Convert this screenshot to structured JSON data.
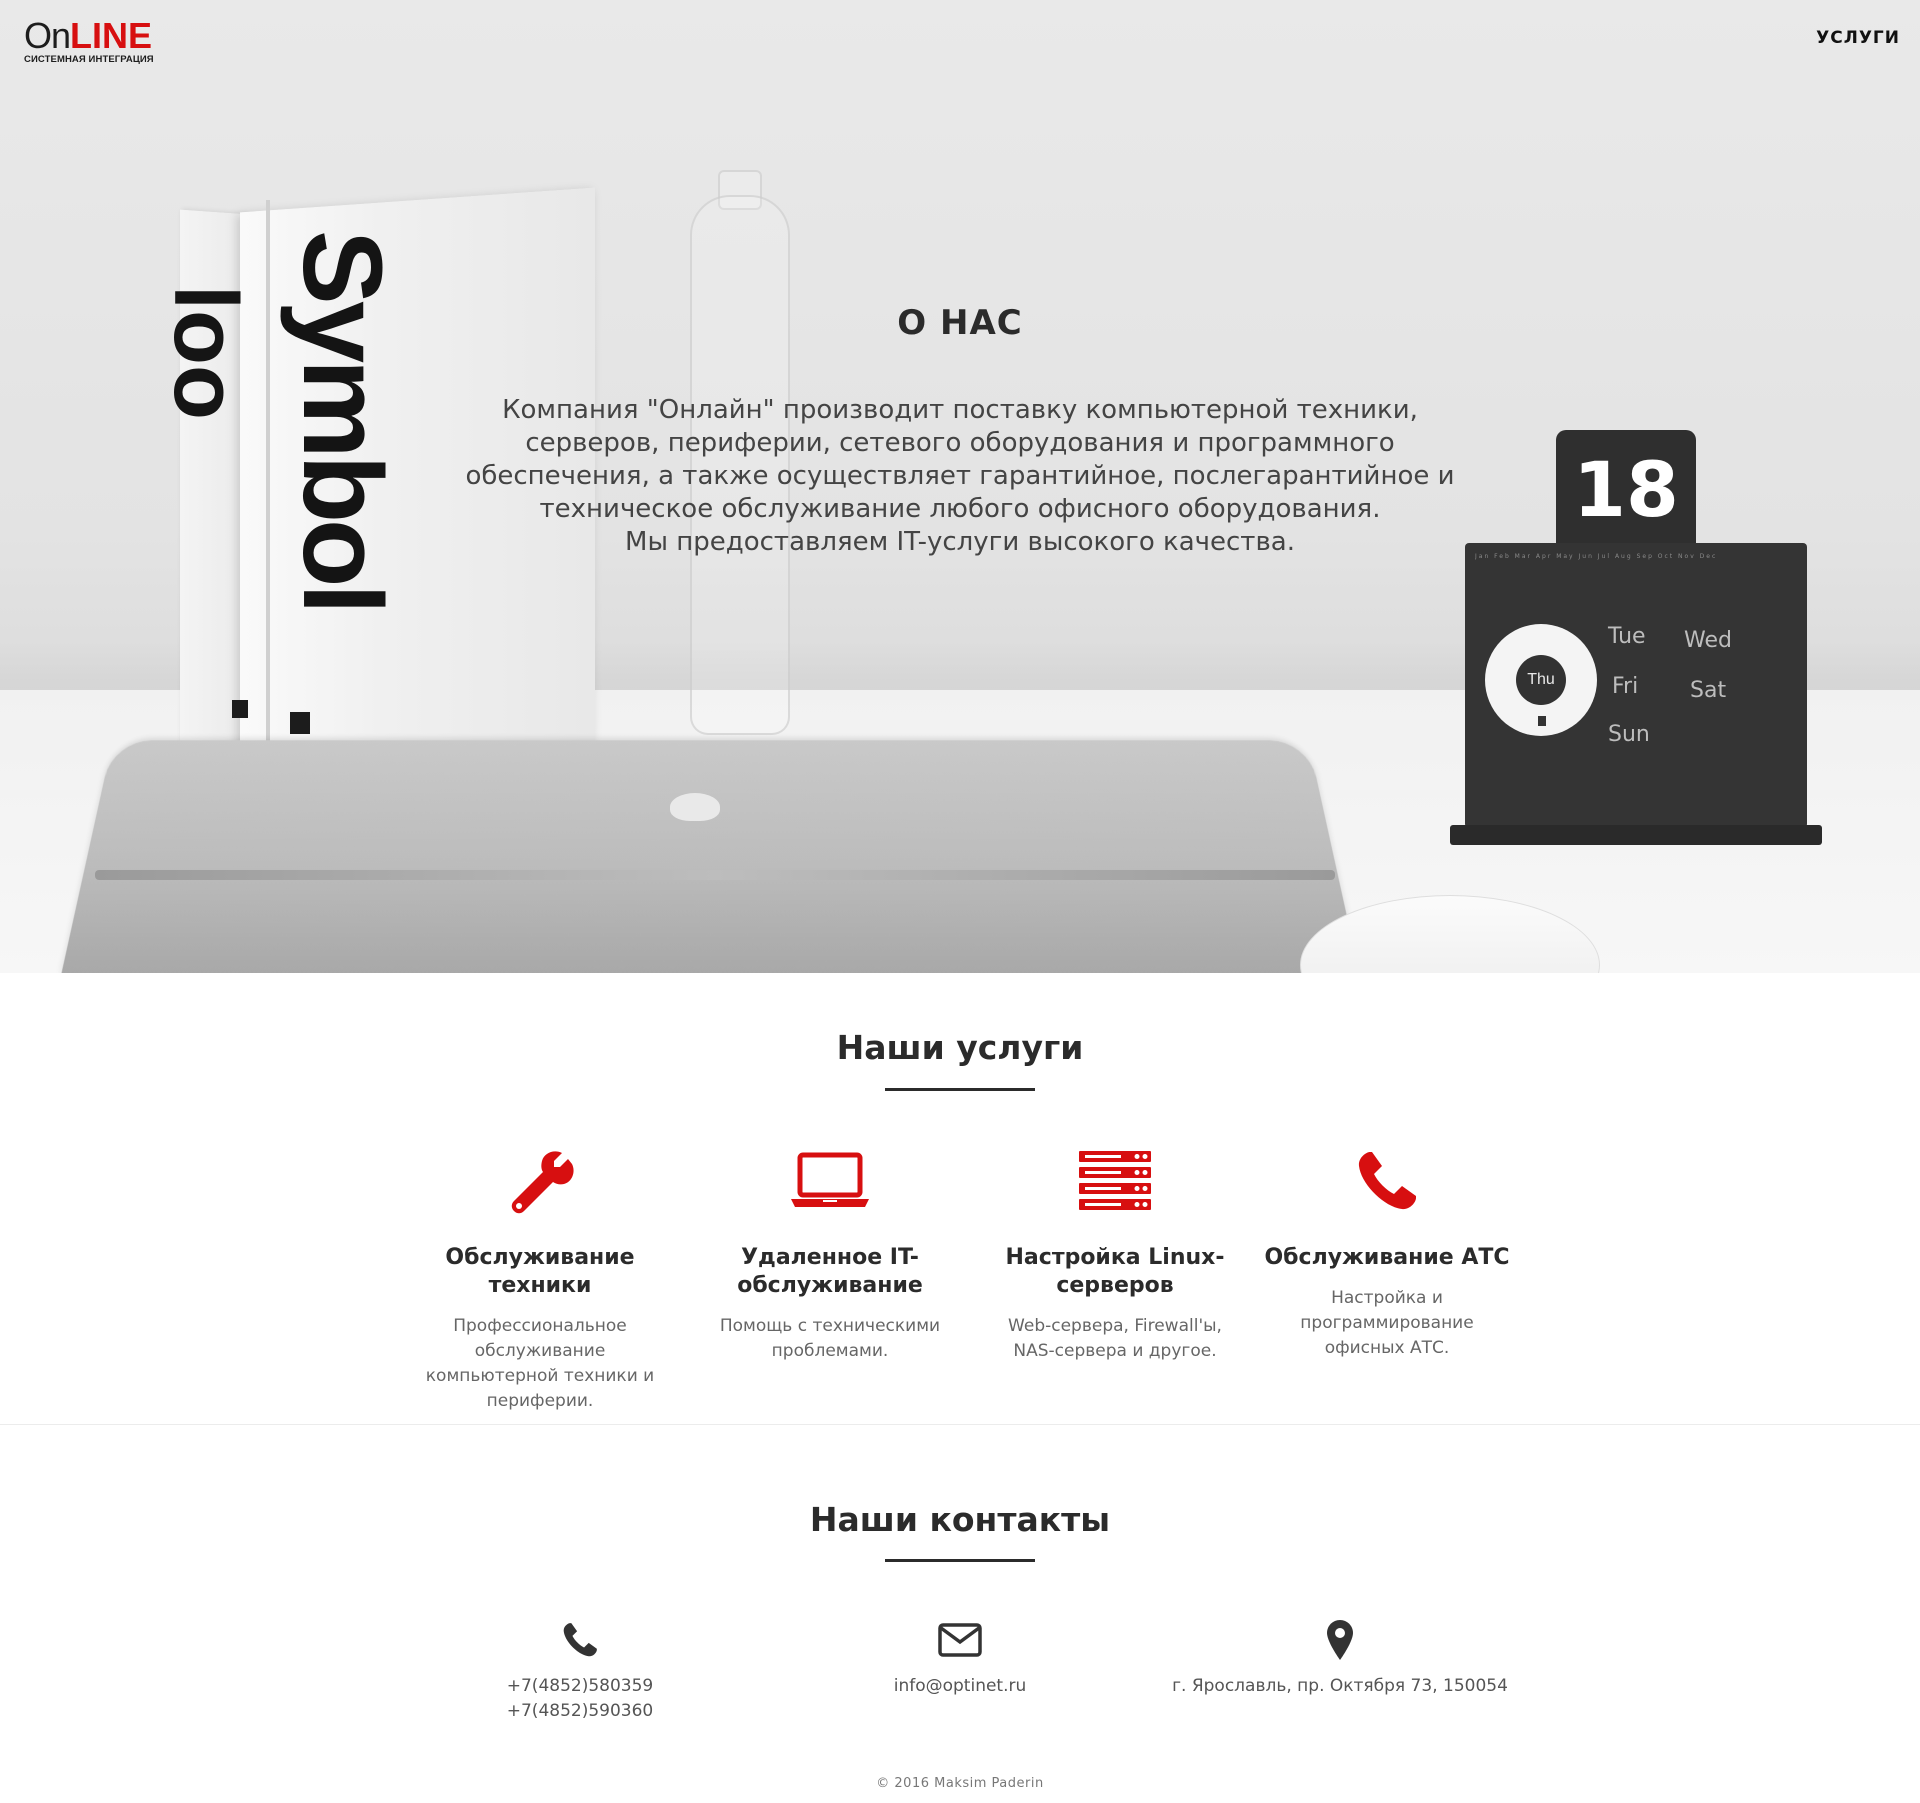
{
  "header": {
    "logo": {
      "on": "On",
      "line": "LINE",
      "subtitle": "СИСТЕМНАЯ ИНТЕГРАЦИЯ"
    },
    "nav": {
      "services": "УСЛУГИ"
    }
  },
  "hero": {
    "title": "О НАС",
    "lines": [
      "Компания \"Онлайн\" производит поставку компьютерной техники,",
      "серверов, периферии, сетевого оборудования и программного",
      "обеспечения, а также осуществляет гарантийное, послегарантийное и",
      "техническое обслуживание любого офисного оборудования.",
      "Мы предоставляем IT-услуги высокого качества."
    ],
    "photo": {
      "book_text": "Symbol",
      "book_text_2": "loo",
      "calendar_number": "18",
      "calendar_center": "Thu",
      "calendar_days": [
        "Tue",
        "Wed",
        "Fri",
        "Sat",
        "Sun"
      ]
    }
  },
  "services": {
    "title": "Наши услуги",
    "accent_color": "#d70f10",
    "items": [
      {
        "icon": "wrench-icon",
        "title": "Обслуживание техники",
        "text": "Профессиональное обслуживание компьютерной техники и периферии."
      },
      {
        "icon": "laptop-icon",
        "title": "Удаленное IT-обслуживание",
        "text": "Помощь с техническими проблемами."
      },
      {
        "icon": "server-icon",
        "title": "Настройка Linux-серверов",
        "text": "Web-сервера, Firewall'ы, NAS-сервера и другое."
      },
      {
        "icon": "phone-icon",
        "title": "Обслуживание АТС",
        "text": "Настройка и программирование офисных АТС."
      }
    ]
  },
  "contacts": {
    "title": "Наши контакты",
    "phone": {
      "icon": "phone-icon",
      "lines": [
        "+7(4852)580359",
        "+7(4852)590360"
      ]
    },
    "email": {
      "icon": "envelope-icon",
      "value": "info@optinet.ru"
    },
    "address": {
      "icon": "map-marker-icon",
      "value": "г. Ярославль, пр. Октября 73, 150054"
    }
  },
  "footer": {
    "copyright": "© 2016 Maksim Paderin"
  }
}
